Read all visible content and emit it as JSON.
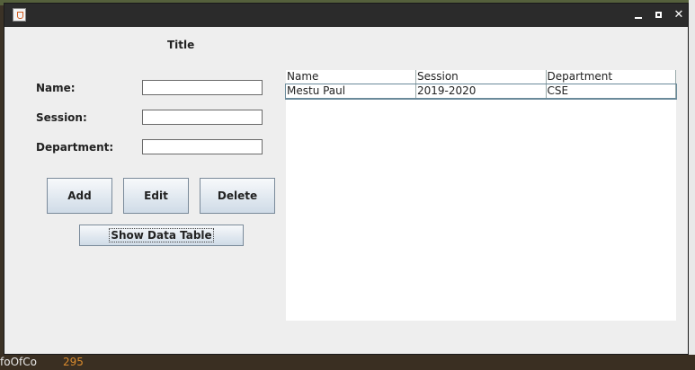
{
  "window": {
    "title": "",
    "controls": {
      "minimize": "minimize",
      "maximize": "maximize",
      "close": "close"
    }
  },
  "background": {
    "text_left": "foOfCo",
    "text_num": "295"
  },
  "form": {
    "title": "Title",
    "fields": [
      {
        "label": "Name:",
        "value": ""
      },
      {
        "label": "Session:",
        "value": ""
      },
      {
        "label": "Department:",
        "value": ""
      }
    ]
  },
  "buttons": {
    "add": "Add",
    "edit": "Edit",
    "delete": "Delete",
    "show_table": "Show Data Table"
  },
  "table": {
    "columns": [
      "Name",
      "Session",
      "Department"
    ],
    "rows": [
      [
        "Mestu Paul",
        "2019-2020",
        "CSE"
      ]
    ]
  }
}
